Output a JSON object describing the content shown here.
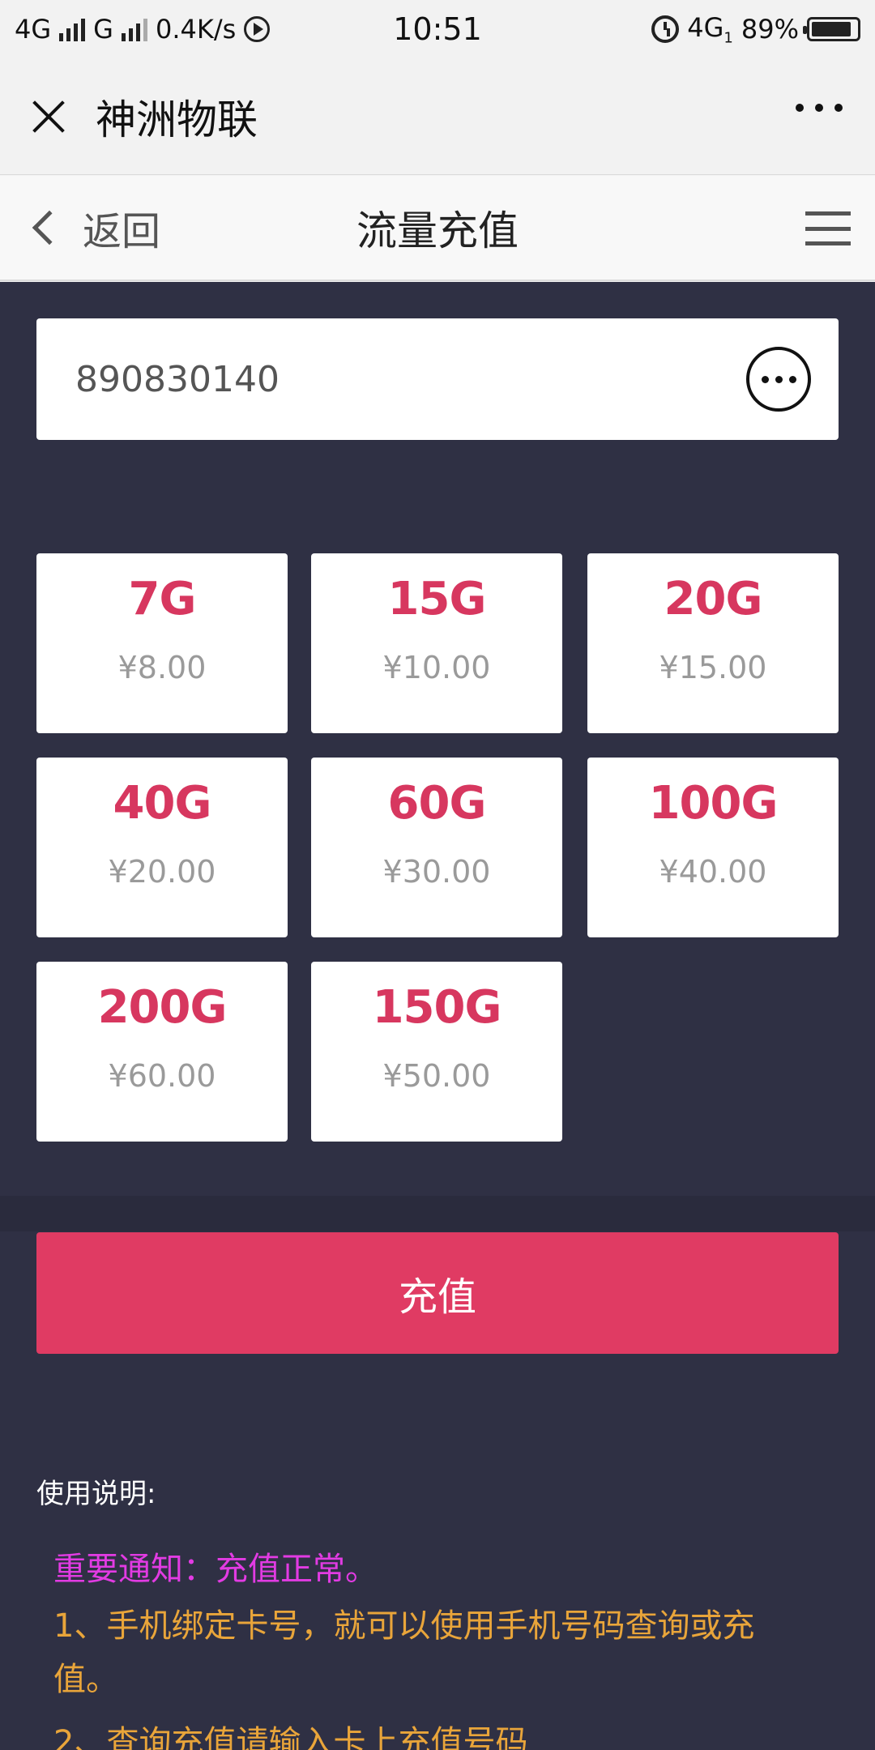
{
  "status_bar": {
    "network1": "4G",
    "network2": "G",
    "speed": "0.4K/s",
    "time": "10:51",
    "network3": "4G",
    "network3_sub": "1",
    "battery": "89%",
    "battery_level": 0.89
  },
  "wechat_header": {
    "title": "神洲物联"
  },
  "page_header": {
    "back_label": "返回",
    "title": "流量充值"
  },
  "card_input": {
    "value": "890830140"
  },
  "plans": [
    {
      "size": "7G",
      "price": "¥8.00"
    },
    {
      "size": "15G",
      "price": "¥10.00"
    },
    {
      "size": "20G",
      "price": "¥15.00"
    },
    {
      "size": "40G",
      "price": "¥20.00"
    },
    {
      "size": "60G",
      "price": "¥30.00"
    },
    {
      "size": "100G",
      "price": "¥40.00"
    },
    {
      "size": "200G",
      "price": "¥60.00"
    },
    {
      "size": "150G",
      "price": "¥50.00"
    }
  ],
  "recharge_button": "充值",
  "instructions": {
    "label": "使用说明:",
    "notice": "重要通知：充值正常。",
    "rule1": "1、手机绑定卡号，就可以使用手机号码查询或充值。",
    "rule2": "2、查询充值请输入卡上充值号码"
  },
  "colors": {
    "accent": "#e03b63",
    "plan_size": "#d7375f",
    "background": "#2f3044",
    "notice": "#e23be3",
    "rule": "#e9a53a"
  }
}
